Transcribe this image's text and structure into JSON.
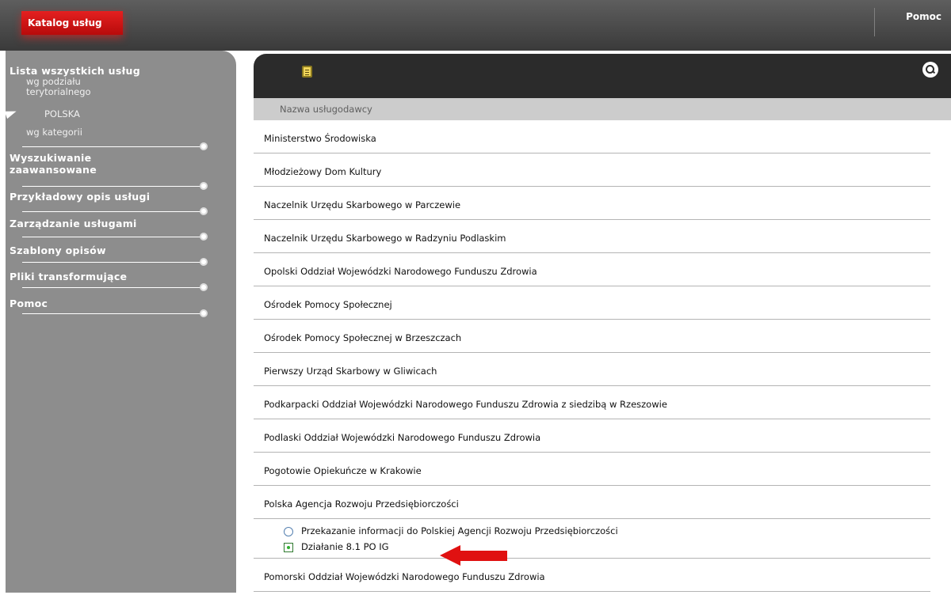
{
  "topbar": {
    "active_tab": "Katalog usług",
    "help_link": "Pomoc"
  },
  "sidebar": {
    "all_services": "Lista wszystkich usług",
    "by_territory": "wg podziału terytorialnego",
    "poland": "POLSKA",
    "by_category": "wg kategorii",
    "items": [
      {
        "label": "Wyszukiwanie zaawansowane"
      },
      {
        "label": "Przykładowy opis usługi"
      },
      {
        "label": "Zarządzanie usługami"
      },
      {
        "label": "Szablony opisów"
      },
      {
        "label": "Pliki transformujące"
      },
      {
        "label": "Pomoc"
      }
    ]
  },
  "main": {
    "header_icons": [
      "document-icon",
      "search-icon"
    ],
    "column_header": "Nazwa usługodawcy",
    "providers": [
      "Ministerstwo Środowiska",
      "Młodzieżowy Dom Kultury",
      "Naczelnik Urzędu Skarbowego w Parczewie",
      "Naczelnik Urzędu Skarbowego w Radzyniu Podlaskim",
      "Opolski Oddział Wojewódzki Narodowego Funduszu Zdrowia",
      "Ośrodek Pomocy Społecznej",
      "Ośrodek Pomocy Społecznej w Brzeszczach",
      "Pierwszy Urząd Skarbowy w Gliwicach",
      "Podkarpacki Oddział Wojewódzki Narodowego Funduszu Zdrowia z siedzibą w Rzeszowie",
      "Podlaski Oddział Wojewódzki Narodowego Funduszu Zdrowia",
      "Pogotowie Opiekuńcze w Krakowie",
      "Polska Agencja Rozwoju Przedsiębiorczości"
    ],
    "services": [
      {
        "label": "Przekazanie informacji do Polskiej Agencji Rozwoju Przedsiębiorczości",
        "selected": false
      },
      {
        "label": "Działanie 8.1 PO IG",
        "selected": true
      }
    ],
    "last_provider": "Pomorski Oddział Wojewódzki Narodowego Funduszu Zdrowia"
  },
  "colors": {
    "accent": "#e01111",
    "sidebar": "#8d8d8d",
    "panel_header": "#2b2b2b"
  }
}
